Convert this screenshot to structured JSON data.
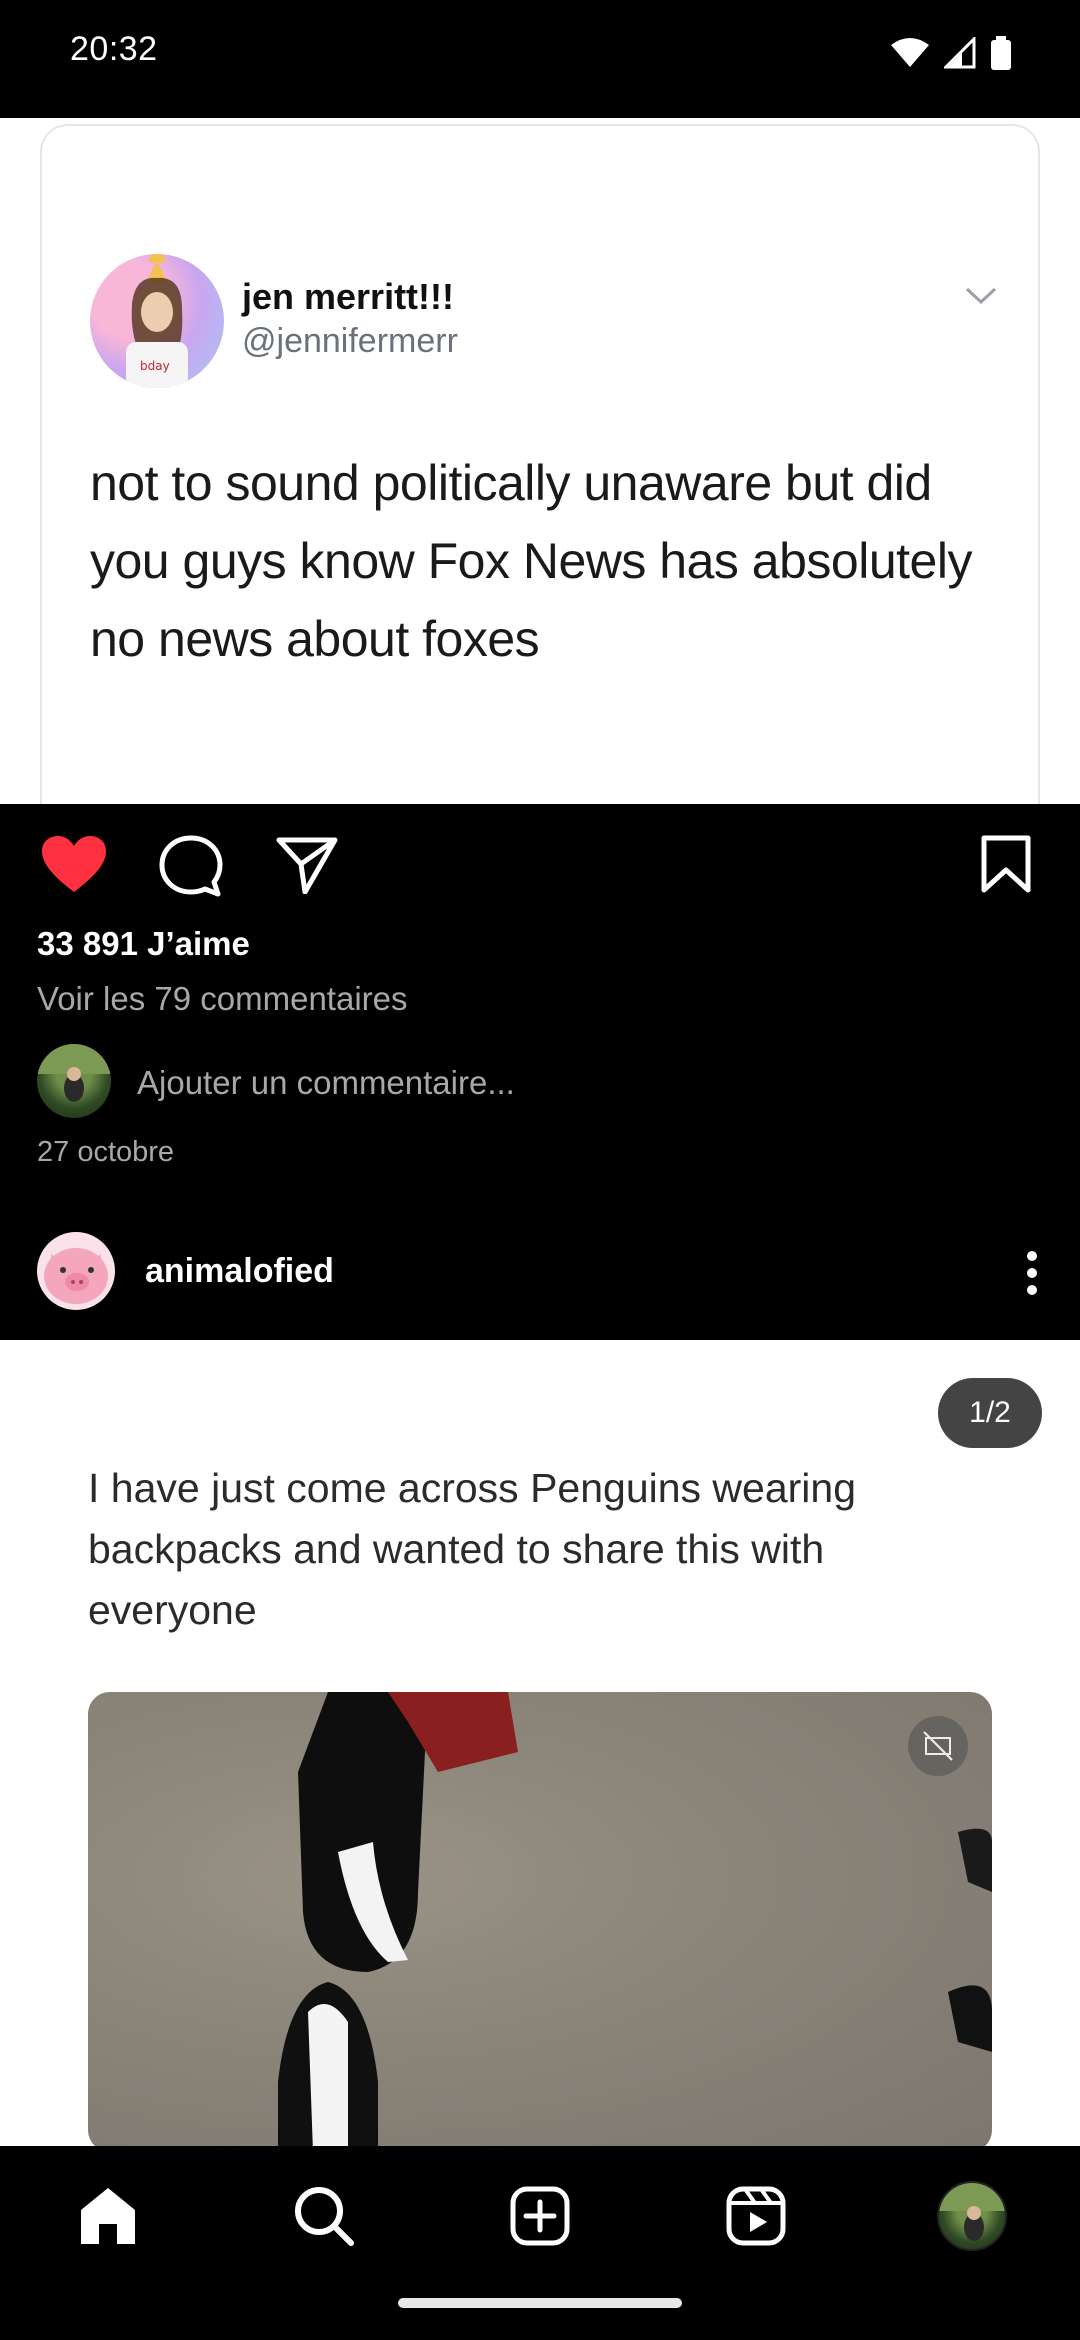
{
  "status_bar": {
    "time": "20:32"
  },
  "post1": {
    "tweet": {
      "name": "jen merritt!!!",
      "handle": "@jennifermerr",
      "text": "not to sound politically unaware but did you guys know Fox News has absolutely no news about foxes"
    },
    "likes": "33 891 J’aime",
    "view_comments": "Voir les 79 commentaires",
    "add_comment_placeholder": "Ajouter un commentaire...",
    "date": "27 octobre"
  },
  "post2": {
    "username": "animalofied",
    "page_counter": "1/2",
    "caption": "I have just come across Penguins wearing backpacks and wanted to share this with everyone"
  },
  "icons": {
    "like": "heart-filled-icon",
    "comment": "comment-bubble-icon",
    "share": "paper-plane-icon",
    "save": "bookmark-icon",
    "more": "more-vertical-icon",
    "nav": [
      "home-icon",
      "search-icon",
      "create-icon",
      "reels-icon",
      "profile-avatar"
    ]
  },
  "colors": {
    "like_red": "#ff3040",
    "muted_text": "#a8a8a8"
  }
}
